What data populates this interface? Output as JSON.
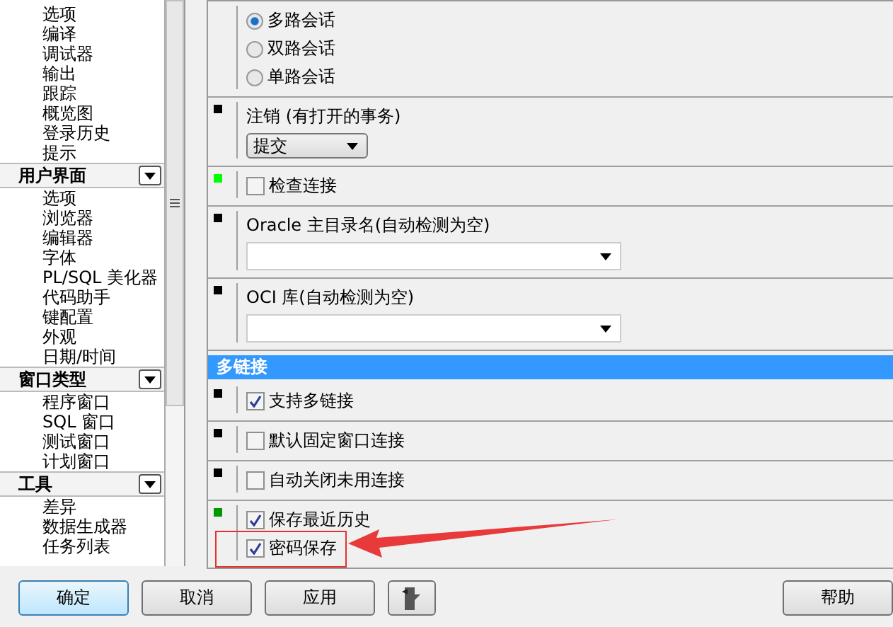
{
  "sidebar": {
    "groups": [
      {
        "items": [
          "选项",
          "编译",
          "调试器",
          "输出",
          "跟踪",
          "概览图",
          "登录历史",
          "提示"
        ]
      },
      {
        "title": "用户界面",
        "expanded": true,
        "items": [
          "选项",
          "浏览器",
          "编辑器",
          "字体",
          "PL/SQL 美化器",
          "代码助手",
          "键配置",
          "外观",
          "日期/时间"
        ]
      },
      {
        "title": "窗口类型",
        "expanded": true,
        "items": [
          "程序窗口",
          "SQL 窗口",
          "测试窗口",
          "计划窗口"
        ]
      },
      {
        "title": "工具",
        "expanded": true,
        "items": [
          "差异",
          "数据生成器",
          "任务列表"
        ]
      }
    ]
  },
  "settings": [
    {
      "kind": "radio",
      "options": [
        {
          "label": "多路会话",
          "selected": true
        },
        {
          "label": "双路会话",
          "selected": false
        },
        {
          "label": "单路会话",
          "selected": false
        }
      ]
    },
    {
      "kind": "select",
      "color": "#000000",
      "label": "注销 (有打开的事务)",
      "value": "提交"
    },
    {
      "kind": "checks",
      "color": "#00ff00",
      "options": [
        {
          "label": "检查连接",
          "checked": false
        }
      ]
    },
    {
      "kind": "combo",
      "color": "#000000",
      "label": "Oracle 主目录名(自动检测为空)"
    },
    {
      "kind": "combo",
      "color": "#000000",
      "label": "OCI 库(自动检测为空)"
    },
    {
      "kind": "header",
      "label": "多链接"
    },
    {
      "kind": "checks",
      "color": "#000000",
      "options": [
        {
          "label": "支持多链接",
          "checked": true
        }
      ]
    },
    {
      "kind": "checks",
      "color": "#000000",
      "options": [
        {
          "label": "默认固定窗口连接",
          "checked": false
        }
      ]
    },
    {
      "kind": "checks",
      "color": "#000000",
      "options": [
        {
          "label": "自动关闭未用连接",
          "checked": false
        }
      ]
    },
    {
      "kind": "checks",
      "color": "#009900",
      "options": [
        {
          "label": "保存最近历史",
          "checked": true,
          "annotated": false
        },
        {
          "label": "密码保存",
          "checked": true,
          "annotated": true
        }
      ]
    }
  ],
  "buttons": [
    {
      "kind": "text",
      "label": "确定",
      "focused": true
    },
    {
      "kind": "text",
      "label": "取消",
      "focused": false
    },
    {
      "kind": "text",
      "label": "应用",
      "focused": false
    },
    {
      "kind": "icon"
    },
    {
      "kind": "spacer"
    },
    {
      "kind": "text",
      "label": "帮助",
      "focused": false
    }
  ]
}
